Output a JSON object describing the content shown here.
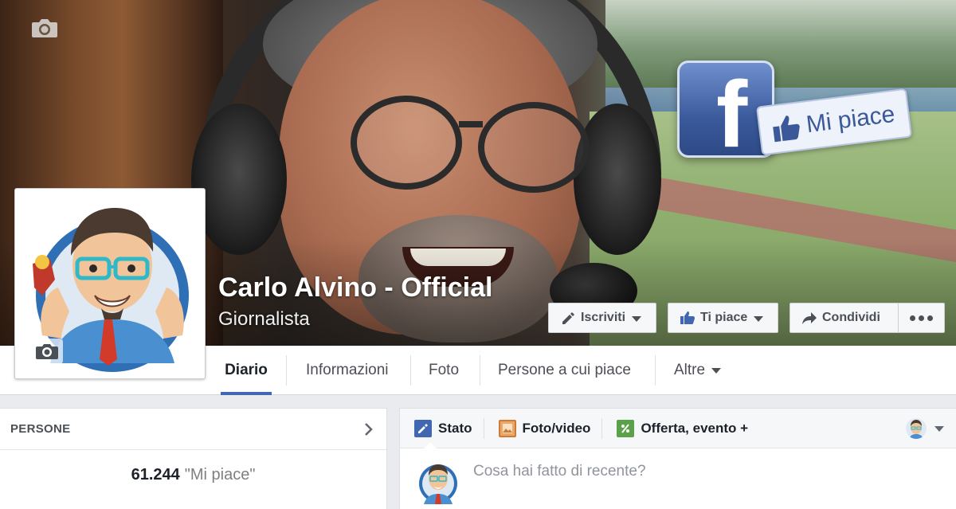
{
  "page": {
    "name": "Carlo Alvino - Official",
    "category": "Giornalista"
  },
  "cover": {
    "badge_like_text": "Mi piace"
  },
  "actions": {
    "subscribe_label": "Iscriviti",
    "like_label": "Ti piace",
    "share_label": "Condividi"
  },
  "nav": {
    "tabs": [
      {
        "label": "Diario",
        "active": true
      },
      {
        "label": "Informazioni"
      },
      {
        "label": "Foto"
      },
      {
        "label": "Persone a cui piace"
      },
      {
        "label": "Altre"
      }
    ]
  },
  "people": {
    "header": "PERSONE",
    "likes_count": "61.244",
    "likes_label": "\"Mi piace\""
  },
  "composer": {
    "tabs": [
      {
        "label": "Stato",
        "icon": "pencil-icon"
      },
      {
        "label": "Foto/video",
        "icon": "photo-icon"
      },
      {
        "label": "Offerta, evento +",
        "icon": "offer-icon"
      }
    ],
    "placeholder": "Cosa hai fatto di recente?"
  },
  "colors": {
    "facebook_blue": "#3b5998",
    "tab_underline": "#4267b2",
    "text_dark": "#1d2129",
    "text_muted": "#90949c"
  }
}
